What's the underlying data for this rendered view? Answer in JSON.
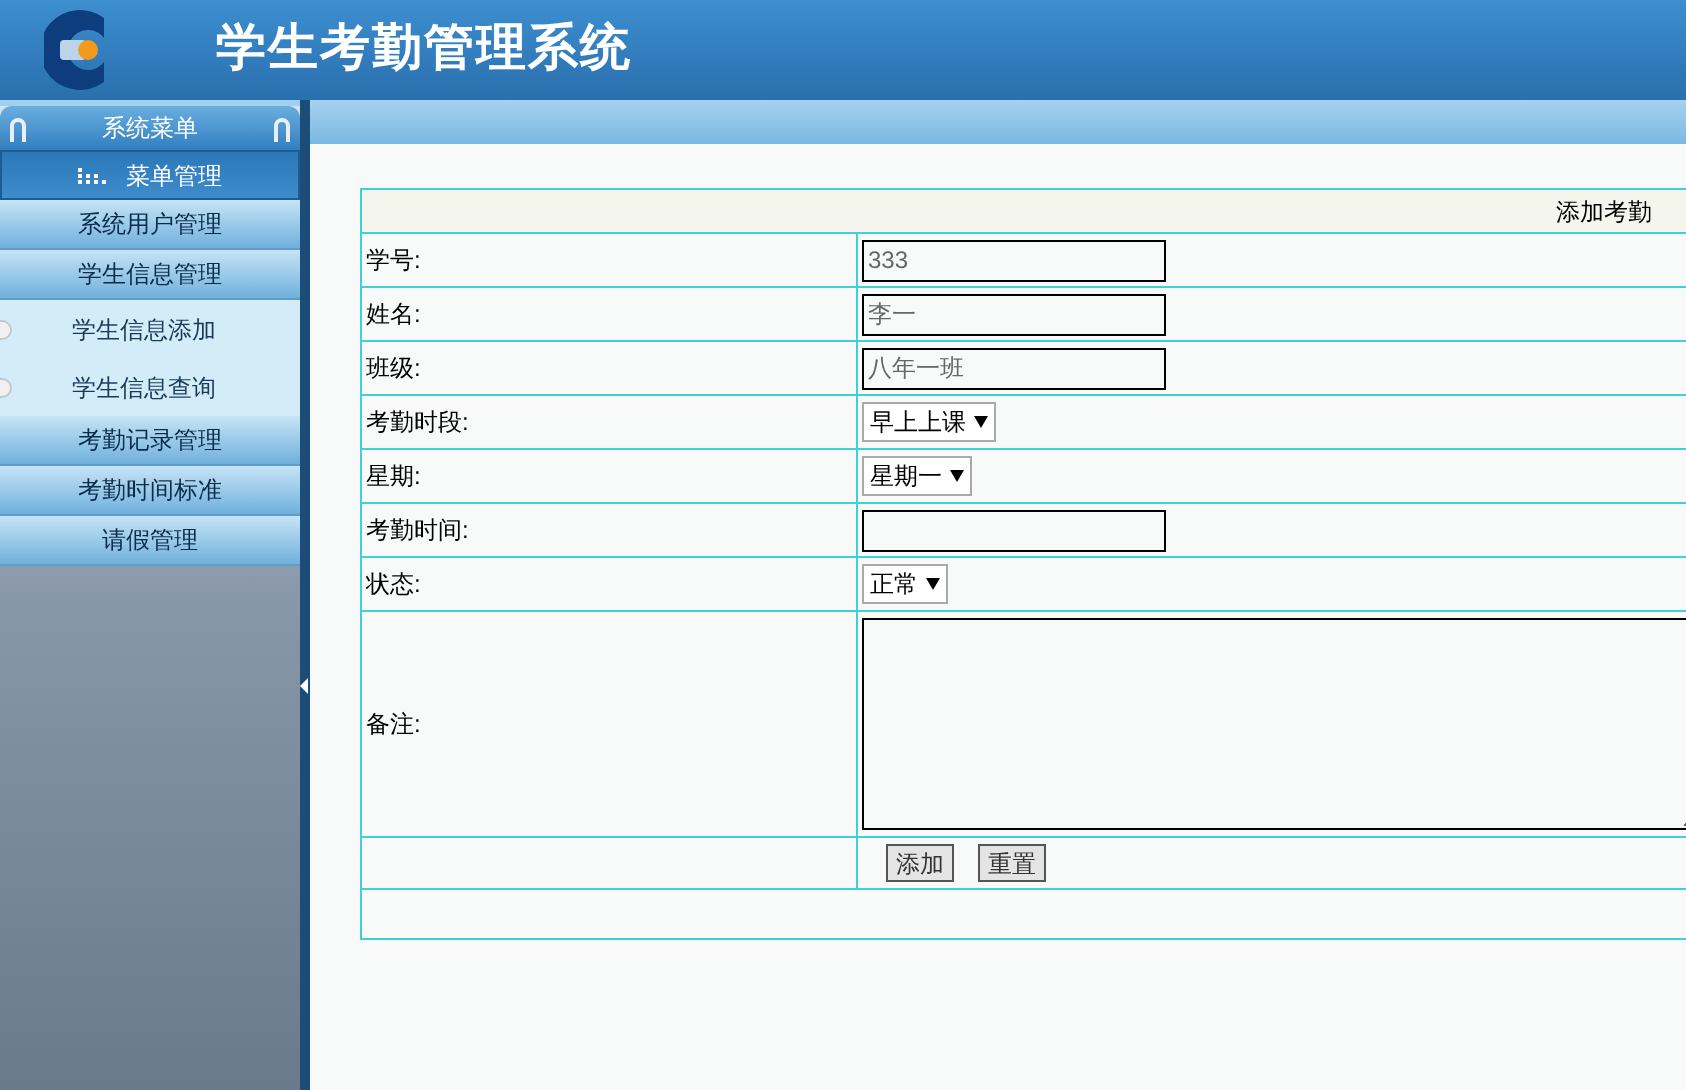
{
  "header": {
    "title": "学生考勤管理系统"
  },
  "sidebar": {
    "title": "系统菜单",
    "section": "菜单管理",
    "items": [
      {
        "kind": "group",
        "label": "系统用户管理"
      },
      {
        "kind": "group",
        "label": "学生信息管理"
      },
      {
        "kind": "sub",
        "label": "学生信息添加"
      },
      {
        "kind": "sub",
        "label": "学生信息查询"
      },
      {
        "kind": "group",
        "label": "考勤记录管理"
      },
      {
        "kind": "group",
        "label": "考勤时间标准"
      },
      {
        "kind": "group",
        "label": "请假管理"
      }
    ]
  },
  "form": {
    "title": "添加考勤",
    "rows": [
      {
        "kind": "text",
        "label": "学号:",
        "value": "333"
      },
      {
        "kind": "text",
        "label": "姓名:",
        "value": "李一"
      },
      {
        "kind": "text",
        "label": "班级:",
        "value": "八年一班"
      },
      {
        "kind": "select",
        "label": "考勤时段:",
        "value": "早上上课"
      },
      {
        "kind": "select",
        "label": "星期:",
        "value": "星期一"
      },
      {
        "kind": "text",
        "label": "考勤时间:"
      },
      {
        "kind": "select",
        "label": "状态:",
        "value": "正常"
      },
      {
        "kind": "textarea",
        "label": "备注:"
      }
    ],
    "buttons": [
      "添加",
      "重置"
    ]
  }
}
